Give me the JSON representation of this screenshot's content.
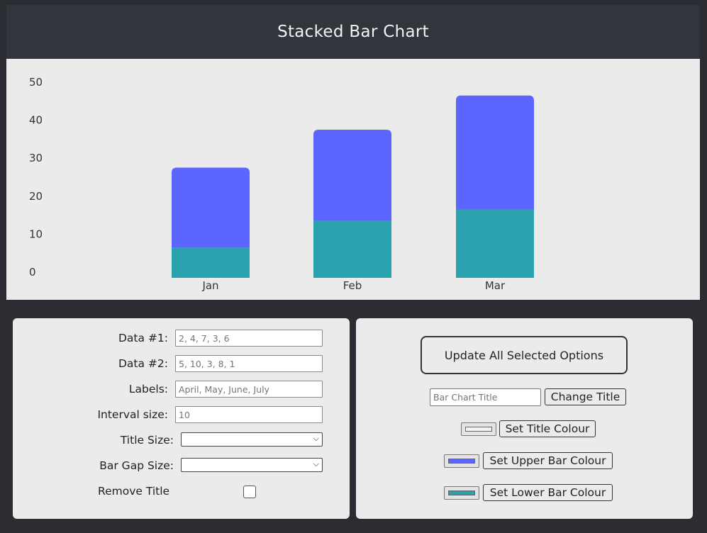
{
  "header": {
    "title": "Stacked Bar Chart"
  },
  "colors": {
    "upper_bar": "#5c66ff",
    "lower_bar": "#2aa2ae",
    "title_swatch": "#f2f2f2",
    "header_bg": "#32353c"
  },
  "chart_data": {
    "type": "bar",
    "stacked": true,
    "categories": [
      "Jan",
      "Feb",
      "Mar"
    ],
    "series": [
      {
        "values": [
          8,
          15,
          18
        ],
        "color": "#2aa2ae"
      },
      {
        "values": [
          21,
          24,
          30
        ],
        "color": "#5c66ff"
      }
    ],
    "yticks": [
      "0",
      "10",
      "20",
      "30",
      "40",
      "50"
    ],
    "ylim": [
      0,
      50
    ],
    "grid": false
  },
  "controls": {
    "data1": {
      "label": "Data #1:",
      "placeholder": "2, 4, 7, 3, 6"
    },
    "data2": {
      "label": "Data #2:",
      "placeholder": "5, 10, 3, 8, 1"
    },
    "labels": {
      "label": "Labels:",
      "placeholder": "April, May, June, July"
    },
    "interval": {
      "label": "Interval size:",
      "placeholder": "10"
    },
    "title_size": {
      "label": "Title Size:"
    },
    "bar_gap": {
      "label": "Bar Gap Size:"
    },
    "remove_title": {
      "label": "Remove Title"
    },
    "update_all": "Update All Selected Options",
    "title_input": {
      "placeholder": "Bar Chart Title"
    },
    "change_title": "Change Title",
    "set_title_colour": "Set Title Colour",
    "set_upper_colour": "Set Upper Bar Colour",
    "set_lower_colour": "Set Lower Bar Colour"
  }
}
